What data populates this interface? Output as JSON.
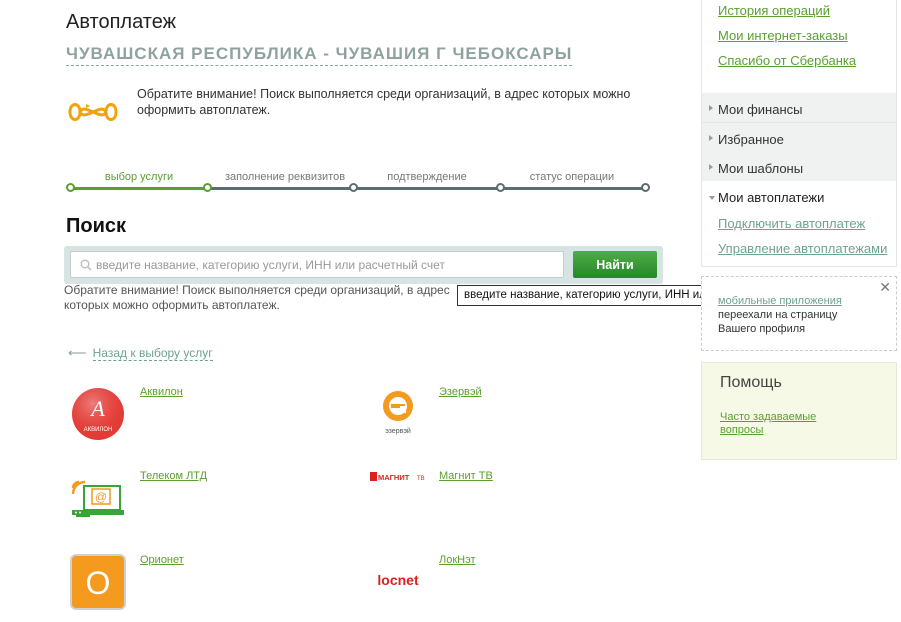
{
  "header": {
    "title": "Автоплатеж",
    "region": "ЧУВАШСКАЯ РЕСПУБЛИКА - ЧУВАШИЯ Г ЧЕБОКСАРЫ",
    "notice": "Обратите внимание! Поиск выполняется среди организаций, в адрес которых можно оформить автоплатеж."
  },
  "steps": [
    {
      "label": "выбор услуги",
      "active": true
    },
    {
      "label": "заполнение реквизитов",
      "active": false
    },
    {
      "label": "подтверждение",
      "active": false
    },
    {
      "label": "статус операции",
      "active": false
    }
  ],
  "search": {
    "title": "Поиск",
    "placeholder": "введите название, категорию услуги, ИНН или расчетный счет",
    "value": "",
    "button_label": "Найти",
    "note": "Обратите внимание! Поиск выполняется среди организаций, в адрес которых можно оформить автоплатеж.",
    "tooltip": "введите название, категорию услуги, ИНН или расчетный счет"
  },
  "back_link": "Назад к выбору услуг",
  "providers": [
    {
      "name": "Аквилон",
      "logo_text": "АКВИЛОН",
      "icon": "akvilon-logo"
    },
    {
      "name": "Эзервэй",
      "logo_text": "эзервэй",
      "icon": "ezerway-logo"
    },
    {
      "name": "Телеком ЛТД",
      "icon": "telecom-ltd-logo"
    },
    {
      "name": "Магнит ТВ",
      "logo_text": "МАГНИТ ТВ",
      "icon": "magnit-tv-logo"
    },
    {
      "name": "Орионет",
      "logo_text": "O",
      "icon": "orionet-logo"
    },
    {
      "name": "ЛокНэт",
      "logo_text": "locnet",
      "icon": "locnet-logo"
    }
  ],
  "sidebar": {
    "links": [
      "История операций",
      "Мои интернет-заказы",
      "Спасибо от Сбербанка"
    ],
    "menus": [
      "Мои финансы",
      "Избранное",
      "Мои шаблоны"
    ],
    "autopay": {
      "title": "Мои автоплатежи",
      "items": [
        "Подключить автоплатеж",
        "Управление автоплатежами"
      ]
    },
    "promo": {
      "link": "мобильные приложения",
      "text": "переехали на страницу Вашего профиля"
    },
    "help": {
      "title": "Помощь",
      "link": "Часто задаваемые вопросы"
    }
  },
  "colors": {
    "accent_green": "#5a9f2f",
    "button_green": "#27862c",
    "step_track": "#5c6d70",
    "region_text": "#8fa2a0",
    "help_bg": "#f6f9e6"
  }
}
